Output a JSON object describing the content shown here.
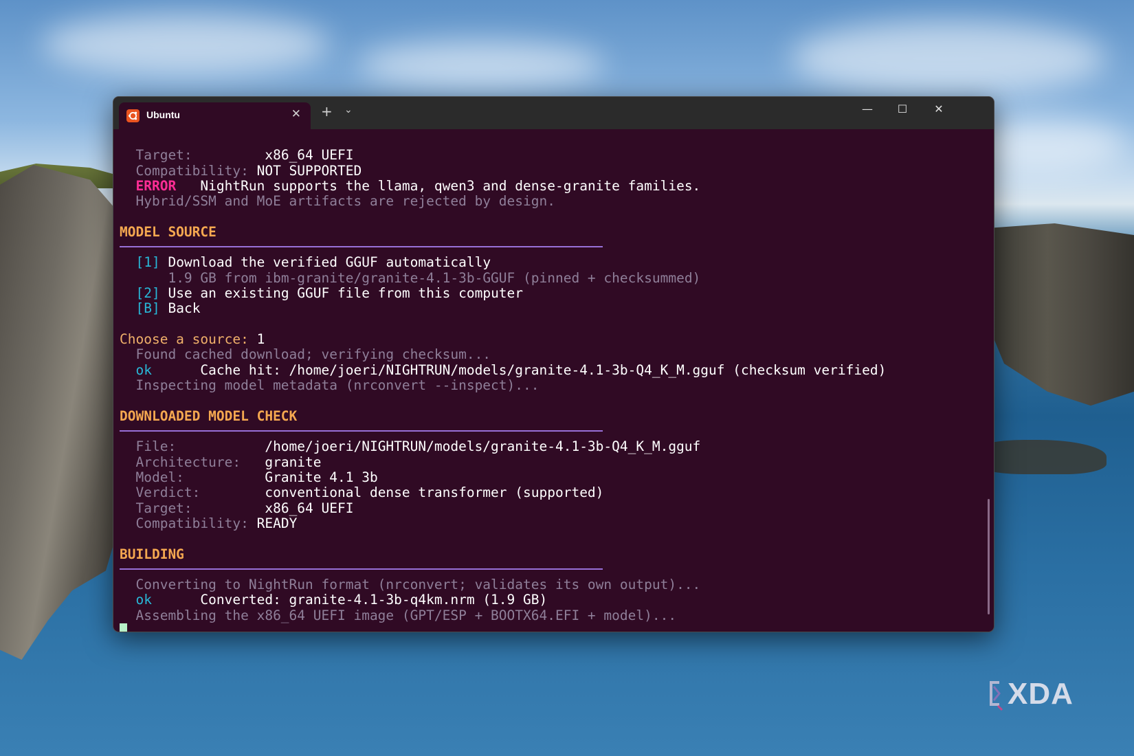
{
  "window": {
    "tab_title": "Ubuntu",
    "tab_icon": "ubuntu-icon",
    "tab_close": "✕",
    "new_tab": "+",
    "dropdown": "⌄",
    "minimize": "—",
    "maximize": "☐",
    "close": "✕"
  },
  "colors": {
    "terminal_bg": "#300a24",
    "heading": "#f5a850",
    "error": "#ff2d95",
    "ok": "#28b8d8",
    "rule": "#9870d8"
  },
  "terminal": {
    "top": {
      "target_label": "Target:",
      "target_value": "x86_64 UEFI",
      "compat_label": "Compatibility:",
      "compat_value": "NOT SUPPORTED",
      "error_tag": "ERROR",
      "error_msg": "NightRun supports the llama, qwen3 and dense-granite families.",
      "error_note": "Hybrid/SSM and MoE artifacts are rejected by design."
    },
    "model_source": {
      "heading": "MODEL SOURCE",
      "opt1_key": "[1]",
      "opt1_label": "Download the verified GGUF automatically",
      "opt1_note": "1.9 GB from ibm-granite/granite-4.1-3b-GGUF (pinned + checksummed)",
      "opt2_key": "[2]",
      "opt2_label": "Use an existing GGUF file from this computer",
      "optb_key": "[B]",
      "optb_label": "Back",
      "prompt": "Choose a source:",
      "answer": "1",
      "found": "Found cached download; verifying checksum...",
      "ok_tag": "ok",
      "cache_hit": "Cache hit: /home/joeri/NIGHTRUN/models/granite-4.1-3b-Q4_K_M.gguf (checksum verified)",
      "inspecting": "Inspecting model metadata (nrconvert --inspect)..."
    },
    "model_check": {
      "heading": "DOWNLOADED MODEL CHECK",
      "file_label": "File:",
      "file_value": "/home/joeri/NIGHTRUN/models/granite-4.1-3b-Q4_K_M.gguf",
      "arch_label": "Architecture:",
      "arch_value": "granite",
      "model_label": "Model:",
      "model_value": "Granite 4.1 3b",
      "verdict_label": "Verdict:",
      "verdict_value": "conventional dense transformer (supported)",
      "target_label": "Target:",
      "target_value": "x86_64 UEFI",
      "compat_label": "Compatibility:",
      "compat_value": "READY"
    },
    "building": {
      "heading": "BUILDING",
      "converting": "Converting to NightRun format (nrconvert; validates its own output)...",
      "ok_tag": "ok",
      "converted": "Converted: granite-4.1-3b-q4km.nrm (1.9 GB)",
      "assembling": "Assembling the x86_64 UEFI image (GPT/ESP + BOOTX64.EFI + model)..."
    }
  },
  "watermark": "XDA"
}
